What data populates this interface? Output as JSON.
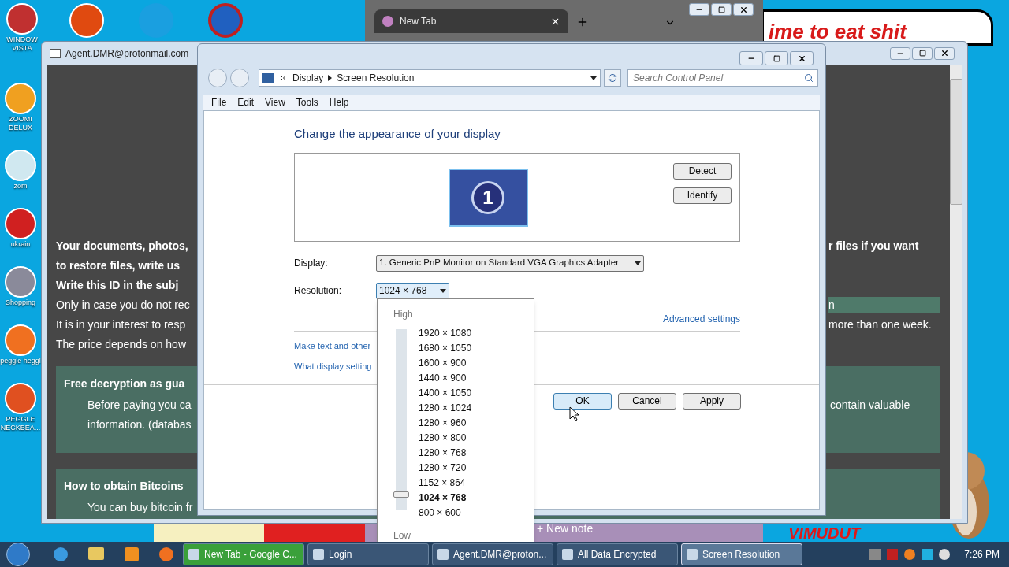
{
  "desktop": {
    "icons_top": [
      {
        "label": "WINDOW VISTA"
      }
    ],
    "icons": [
      {
        "label": "ZOOMI DELUX"
      },
      {
        "label": "zom"
      },
      {
        "label": "ukrain"
      },
      {
        "label": "Shopping"
      },
      {
        "label": "peggle heggl"
      },
      {
        "label": "PEGGLE NECKBEA..."
      }
    ],
    "wallpaper_caption": "ime to eat shit",
    "wallpaper_caption_2": "VIMUDUT",
    "note": {
      "label": "+ New note"
    }
  },
  "browser": {
    "tab": "New Tab"
  },
  "ransom_window": {
    "title": "Agent.DMR@protonmail.com",
    "lines": [
      {
        "kind": "bold",
        "left": "Your documents, photos,",
        "right": {
          "text": "r files if you want",
          "highlighted": false
        }
      },
      {
        "kind": "bold",
        "left": "to restore files, write us"
      },
      {
        "kind": "bold",
        "left": "Write this ID in the subj"
      },
      {
        "kind": "plain",
        "left": "Only in case you do not rec",
        "right": {
          "text": "n",
          "highlighted": true
        }
      },
      {
        "kind": "plain",
        "left": "It is in your interest to resp",
        "right": {
          "text": "more than one week.",
          "highlighted": false
        }
      },
      {
        "kind": "plain",
        "left": "The price depends on how"
      }
    ],
    "panels": [
      {
        "title": "Free decryption as gua",
        "lines": [
          {
            "left": "Before paying you ca",
            "right": "contain valuable"
          },
          {
            "left": "information. (databas"
          }
        ]
      },
      {
        "title": "How to obtain Bitcoins",
        "lines": [
          {
            "left": "You can buy bitcoin fr"
          }
        ]
      }
    ]
  },
  "display_window": {
    "breadcrumb": [
      "Display",
      "Screen Resolution"
    ],
    "search": {
      "placeholder": "Search Control Panel"
    },
    "menu": [
      "File",
      "Edit",
      "View",
      "Tools",
      "Help"
    ],
    "heading": "Change the appearance of your display",
    "monitor_number": "1",
    "monitor_buttons": [
      "Detect",
      "Identify"
    ],
    "display": {
      "label": "Display:",
      "value": "1. Generic PnP Monitor on Standard VGA Graphics Adapter"
    },
    "resolution": {
      "label": "Resolution:",
      "value": "1024 × 768",
      "expanded": true
    },
    "advanced_link": "Advanced settings",
    "links": [
      "Make text and other",
      "What display setting"
    ],
    "buttons": [
      {
        "label": "OK",
        "default": true
      },
      {
        "label": "Cancel",
        "default": false
      },
      {
        "label": "Apply",
        "default": false
      }
    ],
    "popup": {
      "high": "High",
      "low": "Low",
      "slider": {
        "level": 0.08
      },
      "options": [
        {
          "label": "1920 × 1080",
          "selected": false
        },
        {
          "label": "1680 × 1050",
          "selected": false
        },
        {
          "label": "1600 × 900",
          "selected": false
        },
        {
          "label": "1440 × 900",
          "selected": false
        },
        {
          "label": "1400 × 1050",
          "selected": false
        },
        {
          "label": "1280 × 1024",
          "selected": false
        },
        {
          "label": "1280 × 960",
          "selected": false
        },
        {
          "label": "1280 × 800",
          "selected": false
        },
        {
          "label": "1280 × 768",
          "selected": false
        },
        {
          "label": "1280 × 720",
          "selected": false
        },
        {
          "label": "1152 × 864",
          "selected": false
        },
        {
          "label": "1024 × 768",
          "selected": true
        },
        {
          "label": "800 × 600",
          "selected": false
        }
      ]
    }
  },
  "taskbar": {
    "buttons": [
      {
        "label": "New Tab - Google C...",
        "selected": false,
        "flashing": true
      },
      {
        "label": "Login",
        "selected": false,
        "flashing": false
      },
      {
        "label": "Agent.DMR@proton...",
        "selected": false,
        "flashing": false
      },
      {
        "label": "All Data Encrypted",
        "selected": false,
        "flashing": false
      },
      {
        "label": "Screen Resolution",
        "selected": true,
        "flashing": false
      }
    ],
    "clock": "7:26 PM"
  }
}
